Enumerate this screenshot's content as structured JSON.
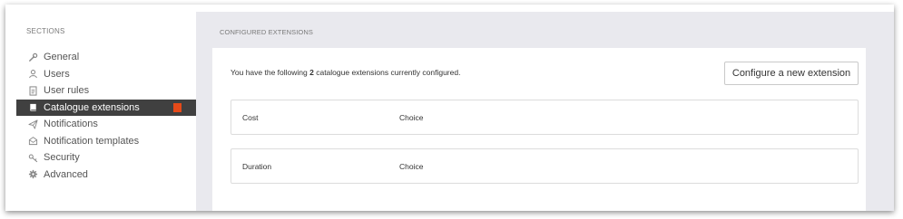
{
  "sidebar": {
    "heading": "SECTIONS",
    "items": [
      {
        "label": "General",
        "icon": "wrench-icon",
        "active": false
      },
      {
        "label": "Users",
        "icon": "user-icon",
        "active": false
      },
      {
        "label": "User rules",
        "icon": "document-icon",
        "active": false
      },
      {
        "label": "Catalogue extensions",
        "icon": "book-icon",
        "active": true,
        "badge_color": "#e64a19"
      },
      {
        "label": "Notifications",
        "icon": "paper-plane-icon",
        "active": false
      },
      {
        "label": "Notification templates",
        "icon": "envelope-icon",
        "active": false
      },
      {
        "label": "Security",
        "icon": "key-icon",
        "active": false
      },
      {
        "label": "Advanced",
        "icon": "gear-icon",
        "active": false
      }
    ]
  },
  "main": {
    "section_heading": "CONFIGURED EXTENSIONS",
    "summary": {
      "prefix": "You have the following ",
      "count": "2",
      "suffix": " catalogue extensions currently configured."
    },
    "configure_button": "Configure a new extension",
    "extensions": [
      {
        "name": "Cost",
        "type": "Choice"
      },
      {
        "name": "Duration",
        "type": "Choice"
      }
    ]
  },
  "colors": {
    "active_bg": "#404040",
    "badge": "#e64a19",
    "main_bg": "#e9e9ee"
  }
}
